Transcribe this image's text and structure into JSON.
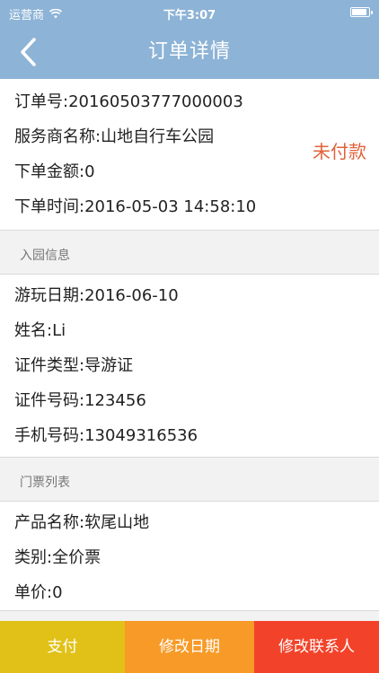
{
  "status_bar": {
    "carrier": "运营商",
    "time": "下午3:07"
  },
  "nav": {
    "title": "订单详情"
  },
  "order": {
    "number_label": "订单号:",
    "number": "20160503777000003",
    "provider_label": "服务商名称:",
    "provider": "山地自行车公园",
    "amount_label": "下单金额:",
    "amount": "0",
    "time_label": "下单时间:",
    "time": "2016-05-03 14:58:10",
    "pay_status": "未付款"
  },
  "visitor_section": {
    "title": "入园信息",
    "date_label": "游玩日期:",
    "date": "2016-06-10",
    "name_label": "姓名:",
    "name": "Li",
    "id_type_label": "证件类型:",
    "id_type": "导游证",
    "id_number_label": "证件号码:",
    "id_number": "123456",
    "phone_label": "手机号码:",
    "phone": "13049316536"
  },
  "ticket_section": {
    "title": "门票列表",
    "product_label": "产品名称:",
    "product": "软尾山地",
    "category_label": "类别:",
    "category": "全价票",
    "price_label": "单价:",
    "price": "0"
  },
  "bottom_bar": {
    "pay_label": "支付",
    "change_date_label": "修改日期",
    "change_contact_label": "修改联系人"
  },
  "colors": {
    "nav_background": "#8db3d6",
    "pay_status": "#e0623a",
    "pay_button": "#e1c118",
    "change_date_button": "#f79a27",
    "change_contact_button": "#f2432a"
  }
}
